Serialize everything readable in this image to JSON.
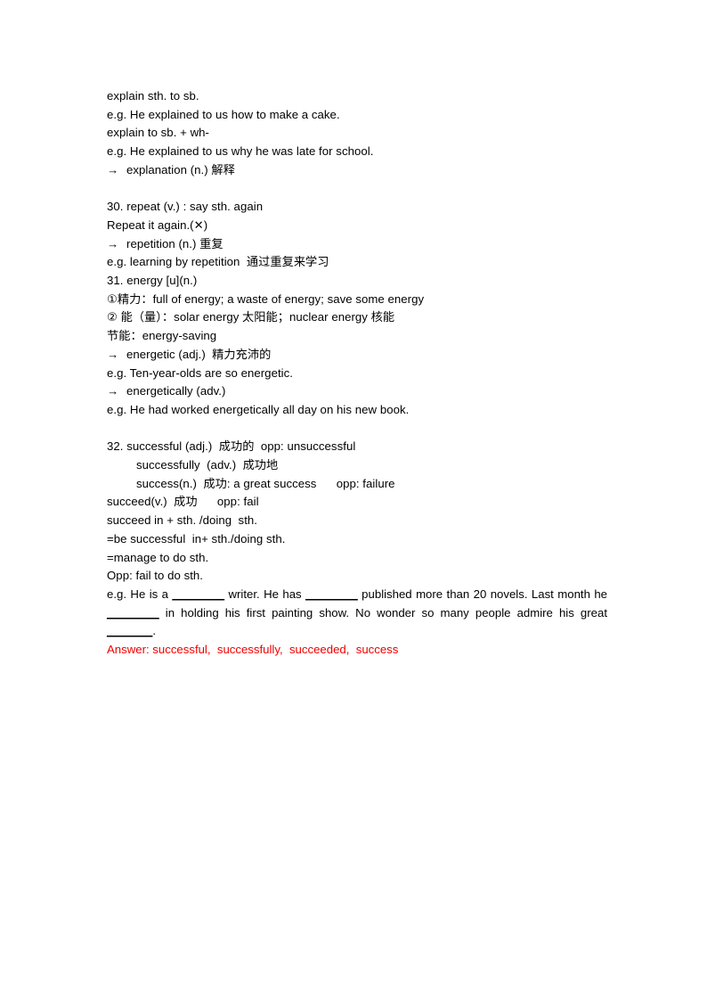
{
  "document": {
    "blocks": [
      {
        "id": "explain-block",
        "lines": [
          {
            "type": "plain",
            "text": "explain sth. to sb."
          },
          {
            "type": "plain",
            "text": "e.g. He explained to us how to make a cake."
          },
          {
            "type": "plain",
            "text": "explain to sb. + wh-"
          },
          {
            "type": "plain",
            "text": "e.g. He explained to us why he was late for school."
          },
          {
            "type": "arrow",
            "arrow": "→",
            "text": "explanation (n.) 解释"
          }
        ]
      },
      {
        "id": "repeat-block",
        "lines": [
          {
            "type": "plain",
            "text": "30. repeat (v.) : say sth. again"
          },
          {
            "type": "plain",
            "text": "Repeat it again.(✕)"
          },
          {
            "type": "arrow",
            "arrow": "→",
            "text": "repetition (n.) 重复"
          },
          {
            "type": "plain",
            "text": "e.g. learning by repetition  通过重复来学习"
          },
          {
            "type": "plain",
            "text": "31. energy [u](n.)"
          },
          {
            "type": "plain",
            "text": "①精力：full of energy; a waste of energy; save some energy"
          },
          {
            "type": "plain",
            "text": "② 能（量）：solar energy 太阳能；nuclear energy 核能"
          },
          {
            "type": "plain",
            "text": "节能：energy-saving"
          },
          {
            "type": "arrow",
            "arrow": "→",
            "text": "energetic (adj.)  精力充沛的"
          },
          {
            "type": "plain",
            "text": "e.g. Ten-year-olds are so energetic."
          },
          {
            "type": "arrow",
            "arrow": "→",
            "text": "energetically (adv.)"
          },
          {
            "type": "plain",
            "text": "e.g. He had worked energetically all day on his new book."
          }
        ]
      },
      {
        "id": "successful-block",
        "lines": [
          {
            "type": "plain",
            "text": "32. successful (adj.)  成功的  opp: unsuccessful"
          },
          {
            "type": "indent",
            "text": "successfully  (adv.)  成功地"
          },
          {
            "type": "indent",
            "text": "success(n.)  成功: a great success      opp: failure"
          },
          {
            "type": "plain",
            "text": "succeed(v.)  成功      opp: fail"
          },
          {
            "type": "plain",
            "text": "succeed in + sth. /doing  sth."
          },
          {
            "type": "plain",
            "text": "=be successful  in+ sth./doing sth."
          },
          {
            "type": "plain",
            "text": "=manage to do sth."
          },
          {
            "type": "plain",
            "text": "Opp: fail to do sth."
          }
        ]
      }
    ],
    "exercise": {
      "segments": [
        "e.g. He is a ",
        "________",
        " writer. He has ",
        "________",
        " published more than 20 novels. Last month he ",
        "________",
        " in holding his first painting show. No wonder so many people admire his great ",
        "_______",
        "."
      ],
      "part1": "e.g. He is a ",
      "blank1": "________",
      "part2": " writer. He has ",
      "blank2": "________",
      "part3": " published more than 20 novels. Last month he ",
      "blank3": "________",
      "part4": " in holding his first painting show. No wonder so many people admire his great ",
      "blank4": "_______",
      "part5": "."
    },
    "answer": {
      "text": "Answer: successful,  successfully,  succeeded,  success",
      "color": "#ee0000"
    }
  }
}
